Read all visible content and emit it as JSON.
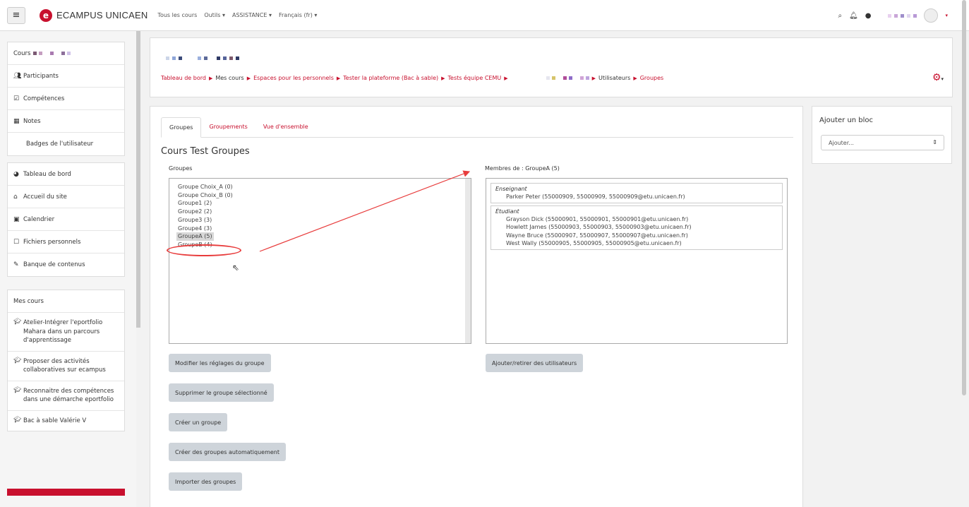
{
  "navbar": {
    "logo_letter": "e",
    "site_name": "ECAMPUS UNICAEN",
    "menu": [
      "Tous les cours",
      "Outils ▾",
      "ASSISTANCE ▾",
      "Français (fr) ▾"
    ],
    "brand_color": "#c8102e"
  },
  "drawer": {
    "course_label": "Cours",
    "course_items": [
      {
        "icon": "users-icon",
        "glyph": "👥",
        "label": "Participants"
      },
      {
        "icon": "checkbox-icon",
        "glyph": "☑",
        "label": "Compétences"
      },
      {
        "icon": "table-icon",
        "glyph": "▦",
        "label": "Notes"
      },
      {
        "icon": "",
        "glyph": "",
        "label": "Badges de l'utilisateur"
      }
    ],
    "nav_items": [
      {
        "icon": "dashboard-icon",
        "glyph": "◕",
        "label": "Tableau de bord"
      },
      {
        "icon": "home-icon",
        "glyph": "⌂",
        "label": "Accueil du site"
      },
      {
        "icon": "calendar-icon",
        "glyph": "▣",
        "label": "Calendrier"
      },
      {
        "icon": "file-icon",
        "glyph": "☐",
        "label": "Fichiers personnels"
      },
      {
        "icon": "brush-icon",
        "glyph": "✎",
        "label": "Banque de contenus"
      }
    ],
    "my_courses_label": "Mes cours",
    "my_courses": [
      "Atelier-Intégrer l'eportfolio Mahara dans un parcours d'apprentissage",
      "Proposer des activités collaboratives sur ecampus",
      "Reconnaitre des compétences dans une démarche eportfolio",
      "Bac à sable Valérie V"
    ]
  },
  "breadcrumb": [
    "Tableau de bord",
    "Mes cours",
    "Espaces pour les personnels",
    "Tester la plateforme (Bac à sable)",
    "Tests équipe CEMU",
    "Utilisateurs",
    "Groupes"
  ],
  "tabs": [
    "Groupes",
    "Groupements",
    "Vue d'ensemble"
  ],
  "main": {
    "title": "Cours Test Groupes",
    "groups_label": "Groupes",
    "members_label": "Membres de : GroupeA (5)",
    "groups": [
      "Groupe Choix_A (0)",
      "Groupe Choix_B (0)",
      "Groupe1 (2)",
      "Groupe2 (2)",
      "Groupe3 (3)",
      "Groupe4 (3)",
      "GroupeA (5)",
      "GroupeB (4)"
    ],
    "selected_group": "GroupeA (5)",
    "teacher_role": "Enseignant",
    "teachers": [
      "Parker Peter (55000909, 55000909, 55000909@etu.unicaen.fr)"
    ],
    "student_role": "Étudiant",
    "students": [
      "Grayson Dick (55000901, 55000901, 55000901@etu.unicaen.fr)",
      "Howlett James (55000903, 55000903, 55000903@etu.unicaen.fr)",
      "Wayne Bruce (55000907, 55000907, 55000907@etu.unicaen.fr)",
      "West Wally (55000905, 55000905, 55000905@etu.unicaen.fr)"
    ],
    "buttons": {
      "edit_group": "Modifier les réglages du groupe",
      "delete_group": "Supprimer le groupe sélectionné",
      "create_group": "Créer un groupe",
      "auto_create": "Créer des groupes automatiquement",
      "import_groups": "Importer des groupes",
      "add_remove_users": "Ajouter/retirer des utilisateurs"
    }
  },
  "block": {
    "title": "Ajouter un bloc",
    "select_value": "Ajouter..."
  }
}
